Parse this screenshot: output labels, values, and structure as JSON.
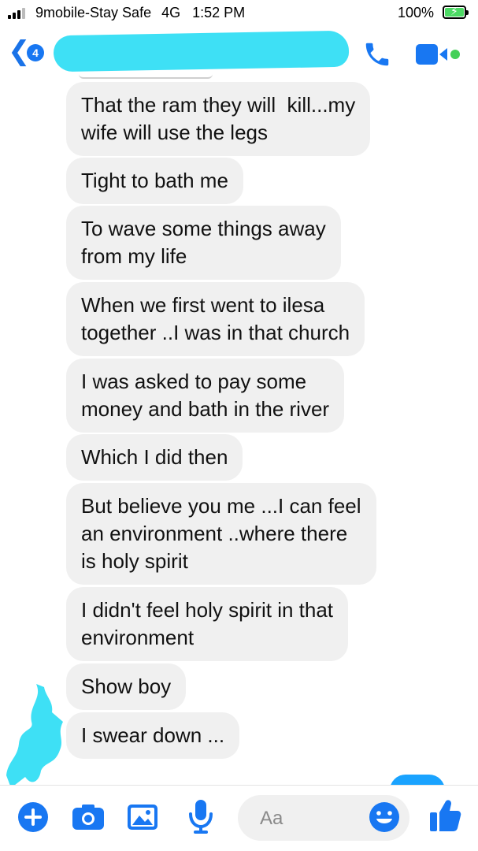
{
  "status_bar": {
    "carrier": "9mobile-Stay Safe",
    "network": "4G",
    "time": "1:52 PM",
    "battery_percent": "100%"
  },
  "nav": {
    "back_count": "4"
  },
  "colors": {
    "accent": "#1877f2",
    "bubble": "#f0f0f0",
    "redaction": "#3ee0f5",
    "online_dot": "#44d058"
  },
  "messages": [
    "That the ram they will  kill...my\nwife will use the legs",
    "Tight to bath me",
    "To wave some things away\nfrom my life",
    "When we first went to ilesa\ntogether ..I was in that church",
    "I was asked to pay some\nmoney and bath in the river",
    "Which I did then",
    "But believe you me ...I can feel\nan environment ..where there\nis holy spirit",
    "I didn't feel holy spirit in that\nenvironment",
    "Show boy",
    "I swear down ..."
  ],
  "composer": {
    "placeholder": "Aa",
    "icons": [
      "plus-icon",
      "camera-icon",
      "photo-icon",
      "microphone-icon",
      "emoji-icon",
      "thumbs-up-icon"
    ]
  }
}
